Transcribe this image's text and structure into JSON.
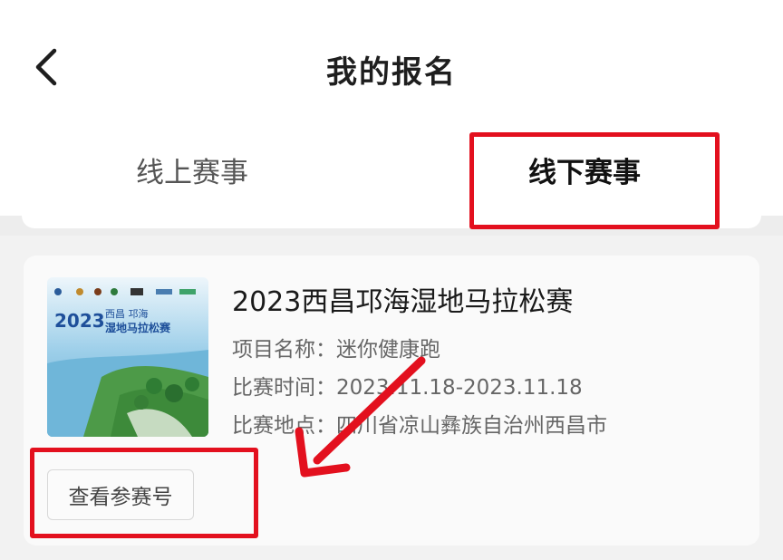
{
  "header": {
    "title": "我的报名",
    "back_icon": "chevron-left-icon"
  },
  "tabs": [
    {
      "label": "线上赛事",
      "active": false
    },
    {
      "label": "线下赛事",
      "active": true
    }
  ],
  "colors": {
    "accent": "#26b0a6",
    "highlight": "#e3101e"
  },
  "event": {
    "title": "2023西昌邛海湿地马拉松赛",
    "poster": {
      "year": "2023",
      "line1": "西昌 邛海",
      "line2": "湿地马拉松赛"
    },
    "rows": [
      {
        "label": "项目名称：",
        "value": "迷你健康跑"
      },
      {
        "label": "比赛时间：",
        "value": "2023.11.18-2023.11.18"
      },
      {
        "label": "比赛地点：",
        "value": "四川省凉山彝族自治州西昌市"
      }
    ],
    "bib_button": "查看参赛号"
  }
}
